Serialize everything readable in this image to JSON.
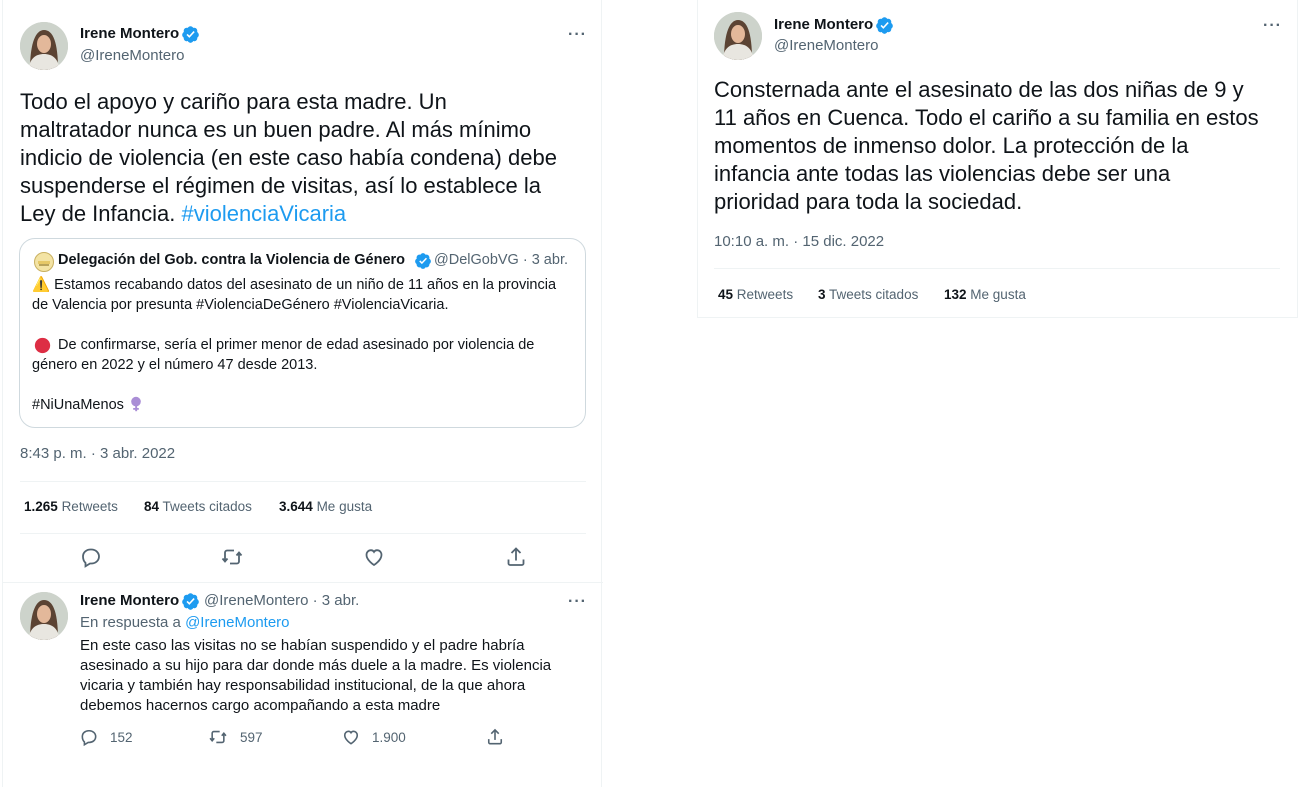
{
  "left_tweet": {
    "author": {
      "name": "Irene Montero",
      "handle": "@IreneMontero"
    },
    "text_lines": [
      "Todo el apoyo y cariño para esta madre. Un",
      "maltratador nunca es un buen padre. Al más mínimo",
      "indicio de violencia (en este caso había condena) debe",
      "suspenderse el régimen de visitas, así lo establece la",
      "Ley de Infancia."
    ],
    "hashtag": "#violenciaVicaria",
    "quote": {
      "name": "Delegación del Gob. contra la Violencia de Género",
      "handle": "@DelGobVG · 3 abr.",
      "line1": "⚠️ Estamos recabando datos del asesinato de un niño de 11 años en la provincia",
      "line2": "de Valencia por presunta #ViolenciaDeGénero #ViolenciaVicaria.",
      "line3": "De confirmarse, sería el primer menor de edad asesinado por violencia de",
      "line4": "género en 2022 y el número 47 desde 2013.",
      "line5": "#NiUnaMenos"
    },
    "timestamp": "8:43 p. m. · 3 abr. 2022",
    "stats": {
      "retweets_count": "1.265",
      "retweets_label": "Retweets",
      "quotes_count": "84",
      "quotes_label": "Tweets citados",
      "likes_count": "3.644",
      "likes_label": "Me gusta"
    }
  },
  "reply_tweet": {
    "author": {
      "name": "Irene Montero",
      "handle_time": "@IreneMontero · 3 abr."
    },
    "in_reply_prefix": "En respuesta a",
    "in_reply_handle": "@IreneMontero",
    "text_lines": [
      "En este caso las visitas no se habían suspendido y el padre habría",
      "asesinado a su hijo para dar donde más duele a la madre. Es violencia",
      "vicaria y también hay responsabilidad institucional, de la que ahora",
      "debemos hacernos cargo acompañando a esta madre"
    ],
    "reply_count": "152",
    "retweet_count": "597",
    "like_count": "1.900"
  },
  "right_tweet": {
    "author": {
      "name": "Irene Montero",
      "handle": "@IreneMontero"
    },
    "text_lines": [
      "Consternada ante el asesinato de las dos niñas de 9 y",
      "11 años en Cuenca. Todo el cariño a su familia en estos",
      "momentos de inmenso dolor. La protección de la",
      "infancia ante todas las violencias debe ser una",
      "prioridad para toda la sociedad."
    ],
    "timestamp": "10:10 a. m. · 15 dic. 2022",
    "stats": {
      "retweets_count": "45",
      "retweets_label": "Retweets",
      "quotes_count": "3",
      "quotes_label": "Tweets citados",
      "likes_count": "132",
      "likes_label": "Me gusta"
    }
  },
  "more_label": "···",
  "colors": {
    "accent": "#1d9bf0",
    "secondary_text": "#536471",
    "border": "#cfd9de"
  }
}
